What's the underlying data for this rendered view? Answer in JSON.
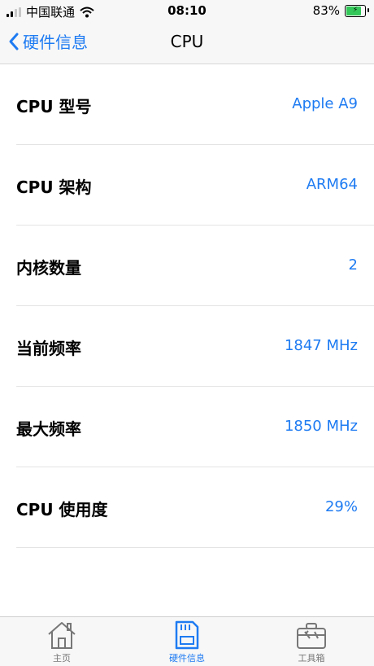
{
  "status_bar": {
    "carrier": "中国联通",
    "time": "08:10",
    "battery_percent": "83%",
    "battery_level": 0.83
  },
  "nav": {
    "back_label": "硬件信息",
    "title": "CPU"
  },
  "rows": [
    {
      "label": "CPU 型号",
      "value": "Apple A9"
    },
    {
      "label": "CPU 架构",
      "value": "ARM64"
    },
    {
      "label": "内核数量",
      "value": "2"
    },
    {
      "label": "当前频率",
      "value": "1847 MHz"
    },
    {
      "label": "最大频率",
      "value": "1850 MHz"
    },
    {
      "label": "CPU 使用度",
      "value": "29%"
    }
  ],
  "tabs": [
    {
      "label": "主页",
      "icon": "house-icon",
      "active": false
    },
    {
      "label": "硬件信息",
      "icon": "sd-card-icon",
      "active": true
    },
    {
      "label": "工具箱",
      "icon": "toolbox-icon",
      "active": false
    }
  ],
  "colors": {
    "accent": "#1e7bf2",
    "battery": "#34c759",
    "inactive": "#777777"
  }
}
